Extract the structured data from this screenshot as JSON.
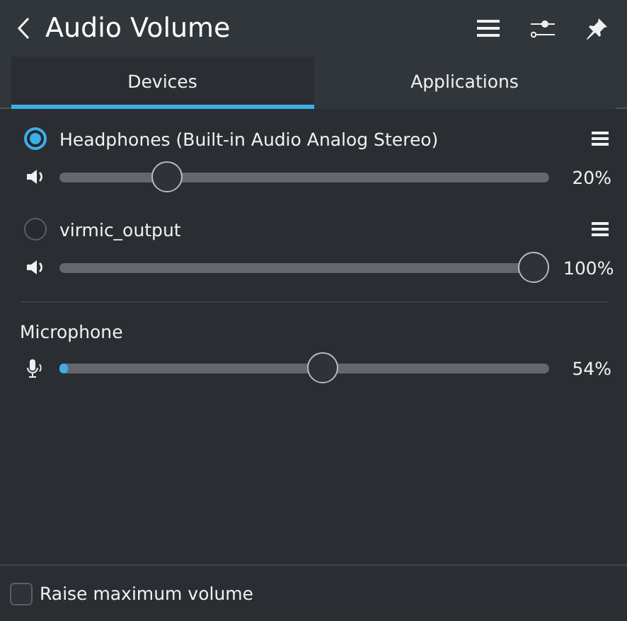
{
  "header": {
    "title": "Audio Volume"
  },
  "tabs": [
    {
      "label": "Devices",
      "selected": true
    },
    {
      "label": "Applications",
      "selected": false
    }
  ],
  "devices": [
    {
      "name": "Headphones (Built-in Audio Analog Stereo)",
      "selected": true,
      "level": 0.2,
      "reading": "20%"
    },
    {
      "name": "virmic_output",
      "selected": false,
      "level": 1,
      "reading": "100%"
    }
  ],
  "microphone": {
    "label": "Microphone",
    "level": 0.54,
    "reading": "54%"
  },
  "options": [
    {
      "label": "Raise maximum volume",
      "checked": false
    }
  ]
}
